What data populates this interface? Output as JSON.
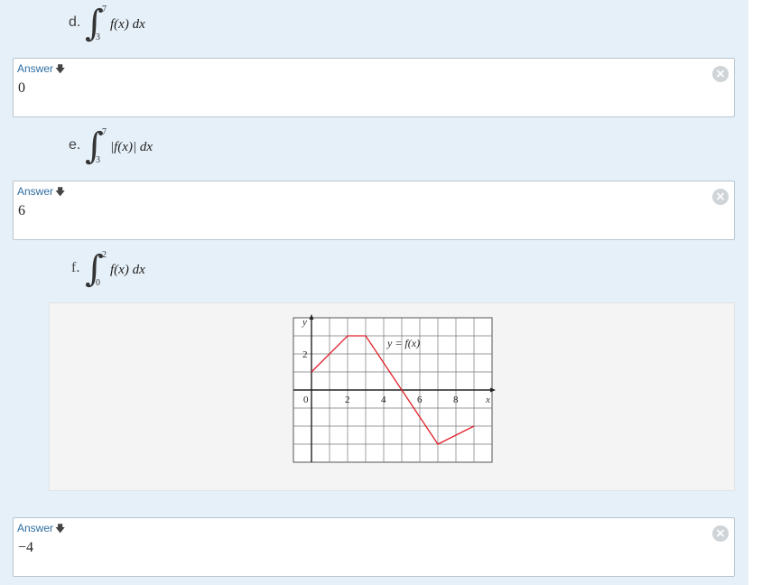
{
  "problems": {
    "d": {
      "letter": "d.",
      "upper": "7",
      "lower": "3",
      "body": "f(x) dx"
    },
    "e": {
      "letter": "e.",
      "upper": "7",
      "lower": "3",
      "body": "|f(x)| dx"
    },
    "f": {
      "letter": "f.",
      "upper": "2",
      "lower": "0",
      "body": "f(x) dx"
    }
  },
  "answers": [
    {
      "label": "Answer",
      "value": "0"
    },
    {
      "label": "Answer",
      "value": "6"
    },
    {
      "label": "Answer",
      "value": "−4"
    }
  ],
  "figure": {
    "y_axis_label": "y",
    "x_axis_label": "x",
    "function_label": "y = f(x)",
    "x_ticks": [
      "0",
      "2",
      "4",
      "6",
      "8"
    ],
    "y_ticks": [
      "2"
    ],
    "graph_points": [
      [
        0,
        1
      ],
      [
        2,
        3
      ],
      [
        3,
        3
      ],
      [
        5,
        0
      ],
      [
        7,
        -3
      ],
      [
        9,
        -2
      ]
    ],
    "line_color": "#e0202a"
  },
  "icons": {
    "arrow": "down-arrow-icon",
    "close": "close-icon"
  }
}
